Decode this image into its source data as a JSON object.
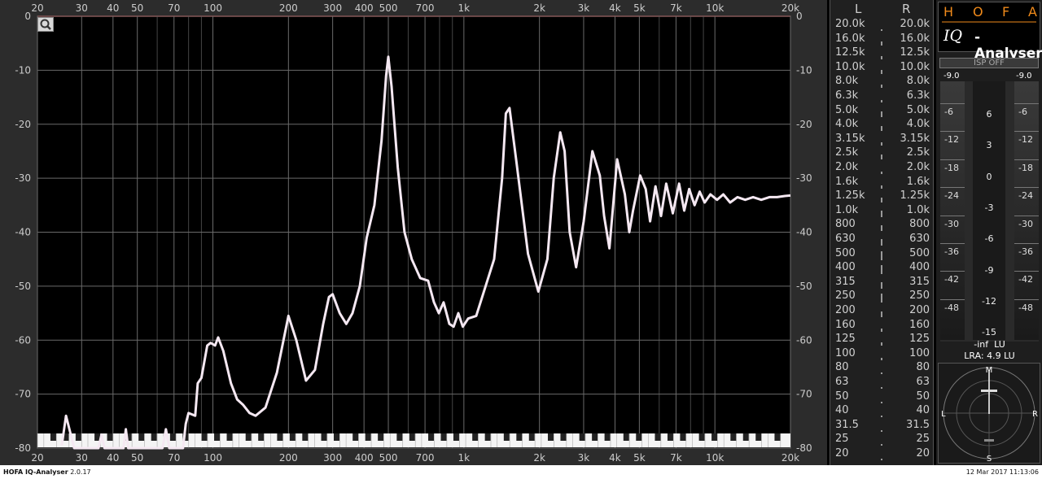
{
  "app": {
    "name": "HOFA IQ-Analyser",
    "version": "2.0.17",
    "timestamp": "12 Mar 2017 11:13:06"
  },
  "colors": {
    "curve": "#f5e8f2",
    "grid": "#6a6a6a",
    "frame": "#2c2c2c",
    "logo_accent": "#f08a1a"
  },
  "chart_data": {
    "type": "line",
    "xscale": "log",
    "xlabel": "",
    "ylabel": "",
    "xlim": [
      20,
      20000
    ],
    "ylim": [
      -80,
      0
    ],
    "x_tick_labels": [
      "20",
      "30",
      "40",
      "50",
      "70",
      "100",
      "200",
      "300",
      "400",
      "500",
      "700",
      "1k",
      "2k",
      "3k",
      "4k",
      "5k",
      "7k",
      "10k",
      "20k"
    ],
    "x_tick_values": [
      20,
      30,
      40,
      50,
      70,
      100,
      200,
      300,
      400,
      500,
      700,
      1000,
      2000,
      3000,
      4000,
      5000,
      7000,
      10000,
      20000
    ],
    "y_tick_labels": [
      "0",
      "-10",
      "-20",
      "-30",
      "-40",
      "-50",
      "-60",
      "-70",
      "-80"
    ],
    "y_tick_values": [
      0,
      -10,
      -20,
      -30,
      -40,
      -50,
      -60,
      -70,
      -80
    ],
    "grid": true,
    "series": [
      {
        "x": [
          25,
          26,
          28,
          35,
          36,
          37,
          44,
          45,
          46,
          63,
          65,
          67,
          76,
          78,
          80,
          85,
          87,
          90,
          95,
          98,
          102,
          105,
          110,
          118,
          125,
          132,
          140,
          148,
          162,
          180,
          200,
          215,
          235,
          255,
          275,
          290,
          300,
          320,
          340,
          360,
          385,
          410,
          440,
          470,
          490,
          500,
          515,
          545,
          580,
          620,
          670,
          720,
          760,
          795,
          830,
          875,
          910,
          950,
          990,
          1040,
          1120,
          1220,
          1320,
          1420,
          1470,
          1520,
          1620,
          1800,
          1980,
          2150,
          2280,
          2420,
          2520,
          2640,
          2800,
          3000,
          3250,
          3480,
          3620,
          3800,
          4080,
          4380,
          4560,
          4720,
          5040,
          5300,
          5520,
          5800,
          6100,
          6400,
          6800,
          7200,
          7550,
          7900,
          8300,
          8700,
          9100,
          9600,
          10200,
          10800,
          11500,
          12300,
          13200,
          14200,
          15300,
          16500,
          17700,
          19000,
          20000
        ],
        "y": [
          -79.5,
          -74,
          -80,
          -80,
          -77.5,
          -80,
          -80,
          -76.5,
          -80,
          -80,
          -76.5,
          -80,
          -80,
          -75.5,
          -73.5,
          -74,
          -68,
          -67,
          -61,
          -60.5,
          -61,
          -59.5,
          -62,
          -68,
          -71,
          -72,
          -73.5,
          -74,
          -72.5,
          -66,
          -55.5,
          -60,
          -67.5,
          -65.5,
          -57,
          -52,
          -51.5,
          -55,
          -57,
          -55,
          -50,
          -41,
          -35,
          -23,
          -11,
          -7.5,
          -13,
          -28,
          -40,
          -45,
          -48.5,
          -49,
          -53,
          -55,
          -53,
          -57,
          -57.5,
          -55,
          -57.5,
          -56,
          -55.5,
          -50,
          -45,
          -30,
          -18,
          -17,
          -27,
          -44,
          -51,
          -45,
          -30,
          -21.5,
          -25,
          -40,
          -46.5,
          -38,
          -25,
          -29.5,
          -37,
          -43,
          -26.5,
          -33,
          -40,
          -36,
          -29.5,
          -32,
          -38,
          -31.5,
          -37,
          -31,
          -36.5,
          -31,
          -36,
          -32,
          -35,
          -32.5,
          -34.5,
          -33,
          -34,
          -33,
          -34.5,
          -33.5,
          -34,
          -33.5,
          -34,
          -33.5,
          -33.5,
          -33.3,
          -33.2
        ]
      }
    ]
  },
  "bands": {
    "left_header": "L",
    "right_header": "R",
    "labels": [
      "20.0k",
      "16.0k",
      "12.5k",
      "10.0k",
      "8.0k",
      "6.3k",
      "5.0k",
      "4.0k",
      "3.15k",
      "2.5k",
      "2.0k",
      "1.6k",
      "1.25k",
      "1.0k",
      "800",
      "630",
      "500",
      "400",
      "315",
      "250",
      "200",
      "160",
      "125",
      "100",
      "80",
      "63",
      "50",
      "40",
      "31.5",
      "25",
      "20"
    ],
    "levels": [
      0.05,
      0.35,
      0.3,
      0.35,
      0.3,
      0.2,
      0.5,
      0.45,
      0.3,
      0.4,
      0.2,
      0.3,
      0.4,
      0.6,
      0.5,
      0.55,
      0.75,
      0.75,
      0.6,
      0.8,
      0.5,
      0.3,
      0.3,
      0.2,
      0.1,
      0.1,
      0.1,
      0.1,
      0.1,
      0.05,
      0.05
    ]
  },
  "logo": {
    "letters": [
      "H",
      "O",
      "F",
      "A"
    ],
    "product_prefix": "IQ",
    "product_suffix": "-Analyser"
  },
  "loudness": {
    "isp_button": "ISP OFF",
    "top_left": "-9.0",
    "top_right": "-9.0",
    "side_ticks": [
      "-6",
      "-12",
      "-18",
      "-24",
      "-30",
      "-36",
      "-42",
      "-48"
    ],
    "center_ticks": [
      "6",
      "3",
      "0",
      "-3",
      "-6",
      "-9",
      "-12",
      "-15"
    ],
    "readout": "-inf  LU",
    "lra": "LRA: 4.9 LU"
  },
  "goniometer": {
    "top": "M",
    "left": "L",
    "right": "R",
    "bottom": "S"
  }
}
